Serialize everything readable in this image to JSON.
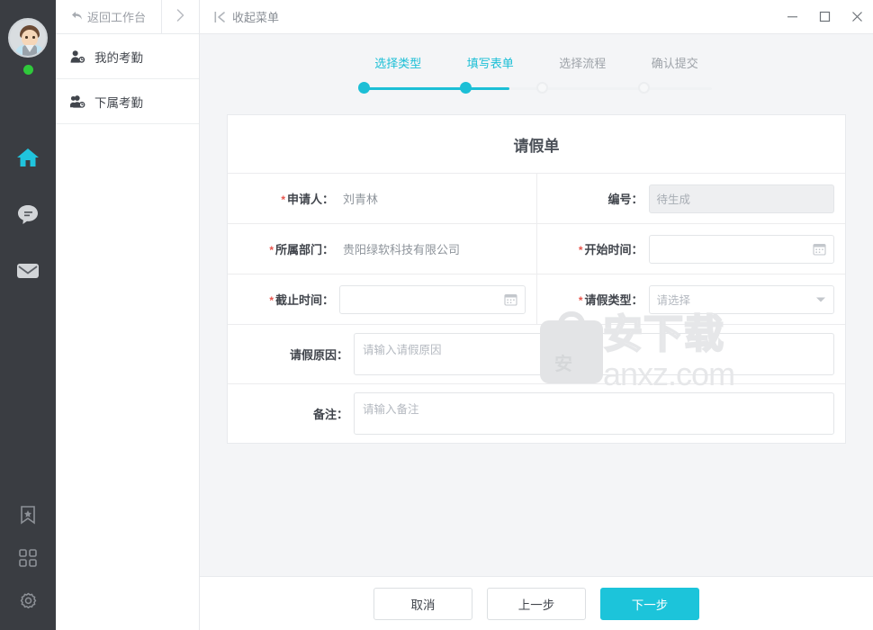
{
  "rail": {
    "avatar_name": "user-avatar",
    "status": "online",
    "icons_top": [
      {
        "name": "home-icon",
        "label": "首页",
        "active": true
      },
      {
        "name": "chat-icon",
        "label": "消息",
        "active": false
      },
      {
        "name": "mail-icon",
        "label": "邮件",
        "active": false
      }
    ],
    "icons_bottom": [
      {
        "name": "bookmark-star-icon",
        "label": "收藏"
      },
      {
        "name": "apps-grid-icon",
        "label": "应用"
      },
      {
        "name": "settings-gear-icon",
        "label": "设置"
      }
    ]
  },
  "sidebar": {
    "back_label": "返回工作台",
    "forward_label": "›",
    "items": [
      {
        "label": "我的考勤",
        "icon": "person-clock-icon"
      },
      {
        "label": "下属考勤",
        "icon": "people-clock-icon"
      }
    ]
  },
  "titlebar": {
    "collapse_label": "收起菜单",
    "minimize": "—",
    "maximize": "▢",
    "close": "✕"
  },
  "steps": {
    "items": [
      {
        "label": "选择类型",
        "active": true
      },
      {
        "label": "填写表单",
        "active": true
      },
      {
        "label": "选择流程",
        "active": false
      },
      {
        "label": "确认提交",
        "active": false
      }
    ]
  },
  "form": {
    "title": "请假单",
    "fields": {
      "applicant_label": "申请人：",
      "applicant_value": "刘青林",
      "number_label": "编号：",
      "number_placeholder": "待生成",
      "department_label": "所属部门：",
      "department_value": "贵阳绿软科技有限公司",
      "start_time_label": "开始时间：",
      "start_time_value": "",
      "end_time_label": "截止时间：",
      "end_time_value": "",
      "leave_type_label": "请假类型：",
      "leave_type_placeholder": "请选择",
      "reason_label": "请假原因：",
      "reason_placeholder": "请输入请假原因",
      "remark_label": "备注：",
      "remark_placeholder": "请输入备注"
    }
  },
  "watermark": {
    "logo_char": "安",
    "brand": "安下载",
    "domain": "anxz.com"
  },
  "footer": {
    "cancel": "取消",
    "prev": "上一步",
    "next": "下一步"
  },
  "colors": {
    "accent": "#1cc4da",
    "rail_bg": "#3a3d42",
    "required": "#e8544c",
    "status_online": "#2fc93b"
  }
}
